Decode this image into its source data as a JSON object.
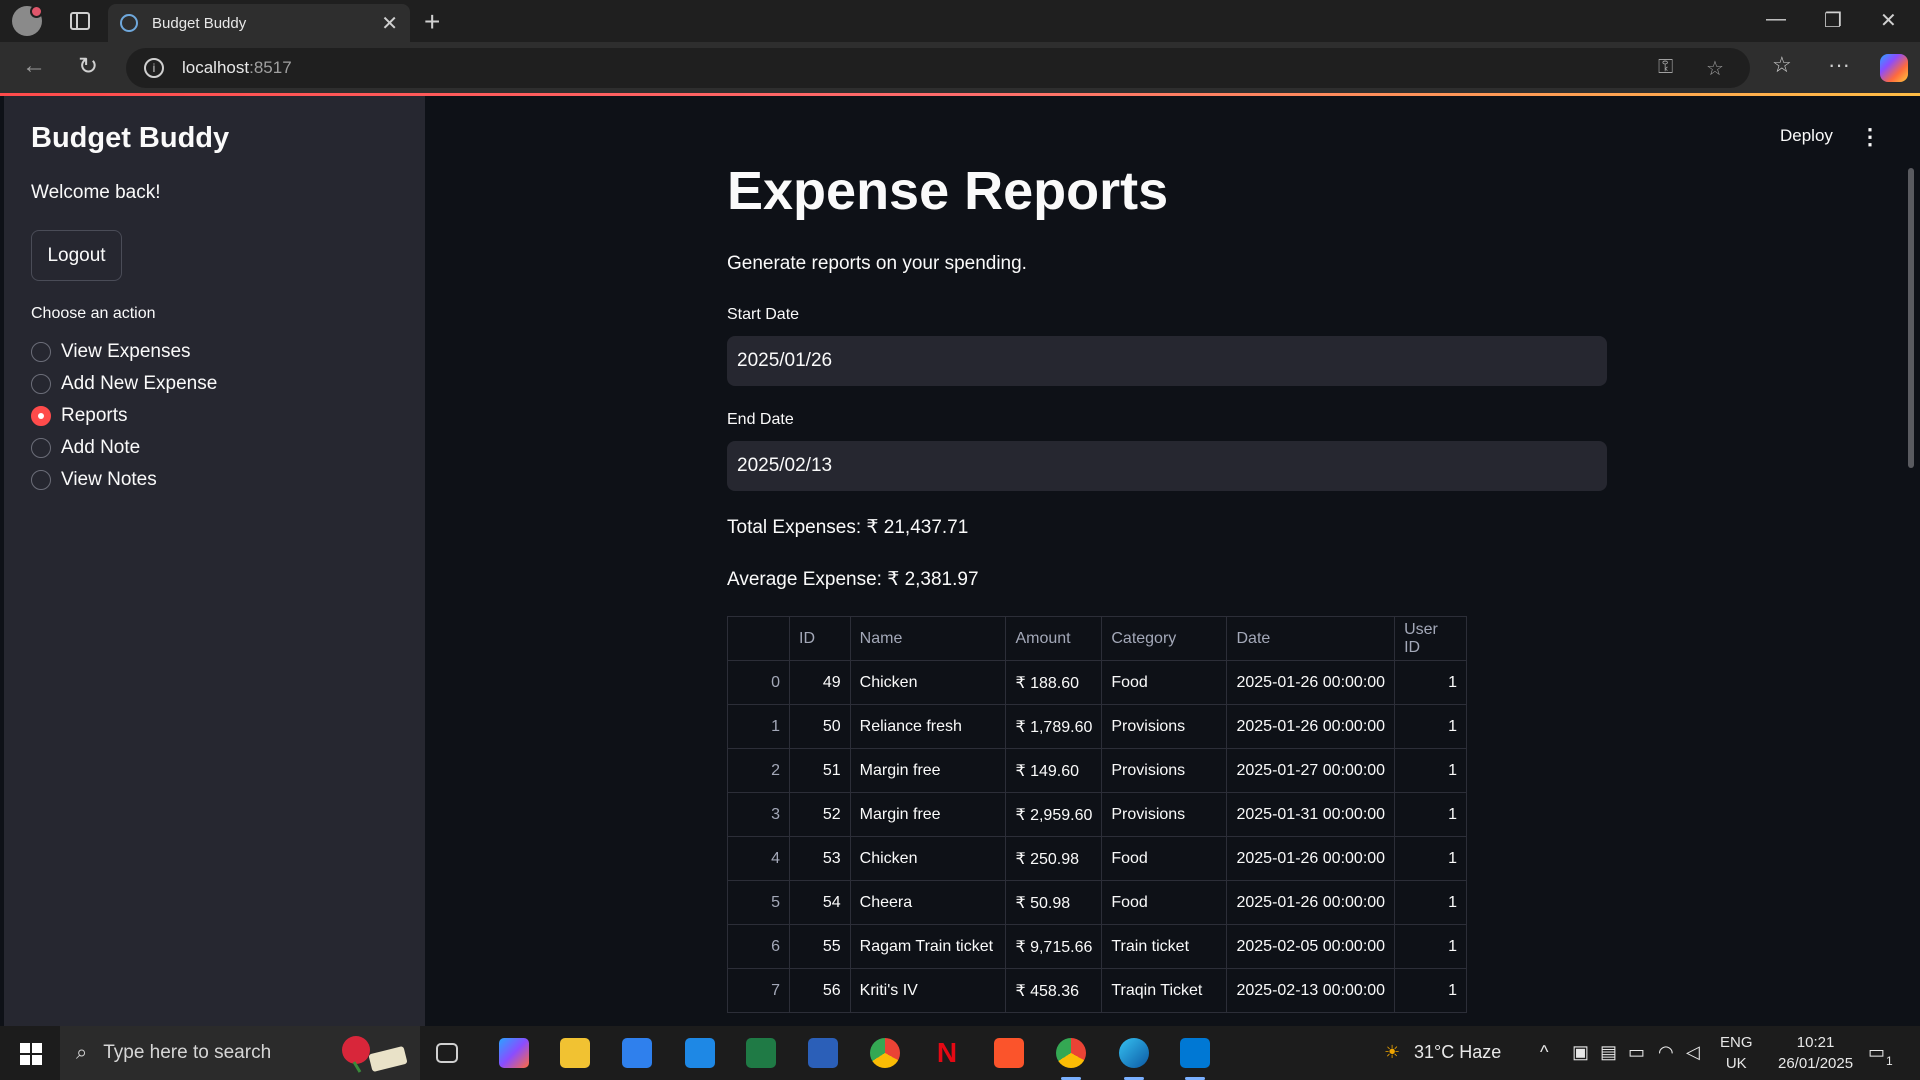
{
  "browser": {
    "tab_title": "Budget Buddy",
    "url_host": "localhost",
    "url_port": ":8517"
  },
  "sidebar": {
    "title": "Budget Buddy",
    "welcome": "Welcome back!",
    "logout_label": "Logout",
    "choose_label": "Choose an action",
    "actions": [
      {
        "label": "View Expenses",
        "selected": false
      },
      {
        "label": "Add New Expense",
        "selected": false
      },
      {
        "label": "Reports",
        "selected": true
      },
      {
        "label": "Add Note",
        "selected": false
      },
      {
        "label": "View Notes",
        "selected": false
      }
    ]
  },
  "header": {
    "deploy_label": "Deploy"
  },
  "main": {
    "title": "Expense Reports",
    "subtitle": "Generate reports on your spending.",
    "start_date_label": "Start Date",
    "start_date_value": "2025/01/26",
    "end_date_label": "End Date",
    "end_date_value": "2025/02/13",
    "total_expenses": "Total Expenses: ₹ 21,437.71",
    "average_expense": "Average Expense: ₹ 2,381.97",
    "table": {
      "columns": [
        "",
        "ID",
        "Name",
        "Amount",
        "Category",
        "Date",
        "User ID"
      ],
      "rows": [
        [
          "0",
          "49",
          "Chicken",
          "₹ 188.60",
          "Food",
          "2025-01-26 00:00:00",
          "1"
        ],
        [
          "1",
          "50",
          "Reliance fresh",
          "₹ 1,789.60",
          "Provisions",
          "2025-01-26 00:00:00",
          "1"
        ],
        [
          "2",
          "51",
          "Margin free",
          "₹ 149.60",
          "Provisions",
          "2025-01-27 00:00:00",
          "1"
        ],
        [
          "3",
          "52",
          "Margin free",
          "₹ 2,959.60",
          "Provisions",
          "2025-01-31 00:00:00",
          "1"
        ],
        [
          "4",
          "53",
          "Chicken",
          "₹ 250.98",
          "Food",
          "2025-01-26 00:00:00",
          "1"
        ],
        [
          "5",
          "54",
          "Cheera",
          "₹ 50.98",
          "Food",
          "2025-01-26 00:00:00",
          "1"
        ],
        [
          "6",
          "55",
          "Ragam Train ticket",
          "₹ 9,715.66",
          "Train ticket",
          "2025-02-05 00:00:00",
          "1"
        ],
        [
          "7",
          "56",
          "Kriti's IV",
          "₹ 458.36",
          "Traqin Ticket",
          "2025-02-13 00:00:00",
          "1"
        ]
      ]
    }
  },
  "taskbar": {
    "search_placeholder": "Type here to search",
    "weather": "31°C  Haze",
    "lang_top": "ENG",
    "lang_bottom": "UK",
    "time": "10:21",
    "date": "26/01/2025",
    "notif_count": "1"
  }
}
